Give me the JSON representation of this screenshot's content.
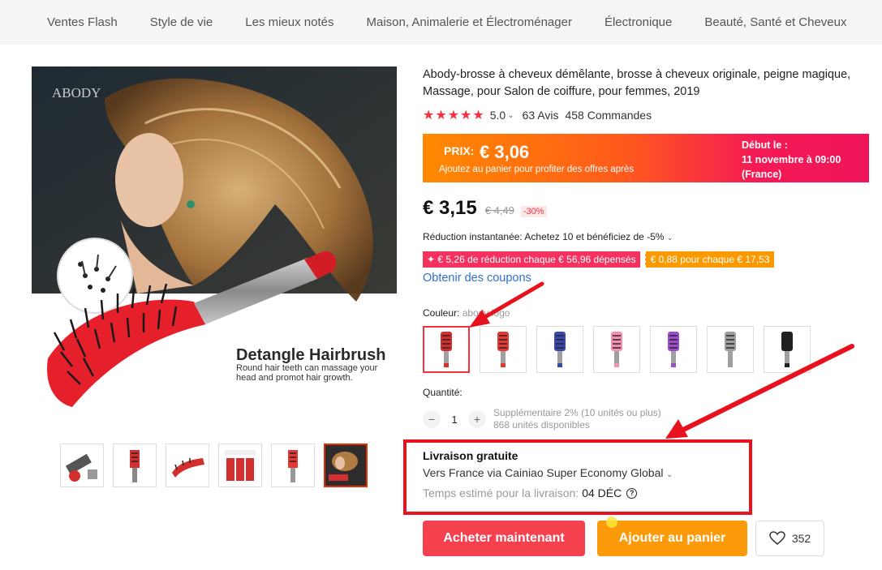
{
  "nav": {
    "items": [
      "Ventes Flash",
      "Style de vie",
      "Les mieux notés",
      "Maison, Animalerie et Électroménager",
      "Électronique",
      "Beauté, Santé et Cheveux"
    ]
  },
  "product": {
    "title": "Abody-brosse à cheveux démêlante, brosse à cheveux originale, peigne magique, Massage, pour Salon de coiffure, pour femmes, 2019",
    "image_brand_text": "ABODY",
    "image_headline": "Detangle Hairbrush",
    "image_subtext": "Round hair teeth can massage your head and promot hair growth.",
    "stars": "★★★★★",
    "rating": "5.0",
    "reviews": "63 Avis",
    "orders": "458 Commandes"
  },
  "promo": {
    "label": "PRIX:",
    "price": "€ 3,06",
    "subtitle": "Ajoutez au panier pour profiter des offres après",
    "start_line1": "Début le :",
    "start_line2": "11 novembre à 09:00",
    "start_line3": "(France)"
  },
  "pricing": {
    "current": "€ 3,15",
    "original": "€ 4,49",
    "discount": "-30%",
    "instant": "Réduction instantanée: Achetez 10 et bénéficiez de -5%",
    "coupon1": "✦ € 5,26 de réduction chaque € 56,96 dépensés",
    "coupon2": "€ 0,88 pour chaque € 17,53",
    "get_coupons": "Obtenir des coupons"
  },
  "options": {
    "color_label": "Couleur:",
    "color_value": "abody logo",
    "swatch_colors": [
      "#d32f2f",
      "#e53935",
      "#3949ab",
      "#f48fb1",
      "#9c4dcc",
      "#9e9e9e",
      "#212121"
    ],
    "quantity_label": "Quantité:",
    "quantity": "1",
    "extra": "Supplémentaire 2% (10 unités ou plus)",
    "available": "868 unités disponibles"
  },
  "shipping": {
    "title": "Livraison gratuite",
    "via": "Vers France via Cainiao Super Economy Global",
    "time_label": "Temps estimé pour la livraison:",
    "time_value": "04 DÉC",
    "help": "?"
  },
  "actions": {
    "buy": "Acheter maintenant",
    "cart": "Ajouter au panier",
    "wishlist_count": "352"
  },
  "colors": {
    "accent_red": "#f5404e",
    "accent_orange": "#fb9a0a",
    "link_blue": "#2e6fcf",
    "annotation_red": "#e8121e"
  }
}
